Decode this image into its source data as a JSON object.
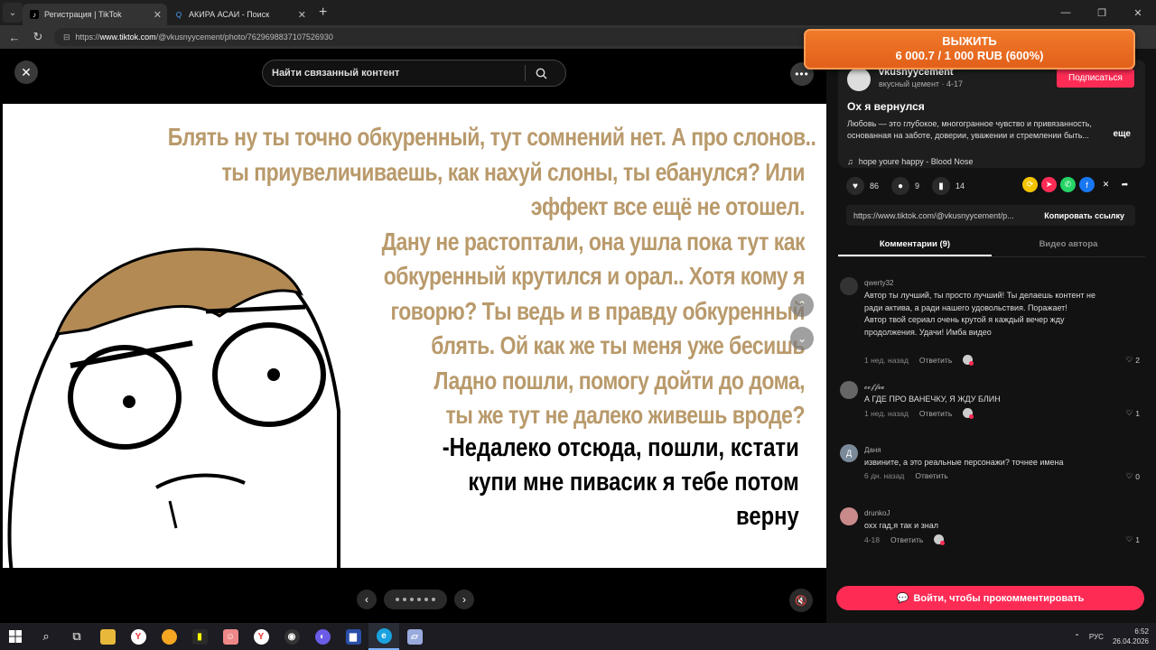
{
  "browser": {
    "tabs": [
      {
        "title": "Регистрация | TikTok",
        "active": true
      },
      {
        "title": "АКИРА АСАИ - Поиск",
        "active": false
      }
    ],
    "url_prefix": "https://",
    "url_domain": "www.tiktok.com",
    "url_path": "/@vkusnyycement/photo/7629698837107526930"
  },
  "viewer": {
    "search_placeholder": "Найти связанный контент",
    "meme_lines": [
      "Блять ну ты точно обкуренный, тут сомнений нет. А про слонов..",
      "ты приувеличиваешь, как нахуй слоны, ты ебанулся? Или",
      "эффект все ещё не отошел.",
      "Дану не растоптали, она ушла пока тут как",
      "обкуренный крутился и орал.. Хотя кому я",
      "говорю? Ты ведь и в правду обкуренный",
      "блять. Ой как же ты меня уже бесишь",
      "Ладно пошли, помогу дойти до дома,",
      "ты же тут не далеко живешь вроде?"
    ],
    "meme_reply": [
      "-Недалеко отсюда, пошли, кстати",
      "купи мне пивасик я тебе потом",
      "верну"
    ]
  },
  "promo": {
    "line1": "ВЫЖИТЬ",
    "line2": "6 000.7 / 1 000 RUB (600%)"
  },
  "author": {
    "name": "vkusnyycement",
    "meta": "вкусный цемент · 4-17",
    "follow_label": "Подписаться",
    "title": "Ох я вернулся",
    "description": "Любовь — это глубокое, многогранное чувство и привязанность, основанная на заботе, доверии, уважении и стремлении быть...",
    "more_label": "еще",
    "music": "hope youre happy - Blood Nose"
  },
  "stats": {
    "likes": "86",
    "comments": "9",
    "saves": "14"
  },
  "share": {
    "link": "https://www.tiktok.com/@vkusnyycement/p...",
    "copy_label": "Копировать ссылку"
  },
  "tabs": {
    "comments": "Комментарии (9)",
    "author_videos": "Видео автора"
  },
  "comments": [
    {
      "user": "qwerty32",
      "text": "Автор ты лучший, ты просто лучший! Ты делаешь контент не ради актива, а ради нашего удовольствия. Поражает!\nАвтор твой сериал очень крутой я каждый вечер жду продолжения. Удачи! Имба видео",
      "time": "1 нед. назад",
      "reply": "Ответить",
      "likes": "2"
    },
    {
      "user": "𝓬𝓸𝓯𝓯𝓮𝓮",
      "text": "А ГДЕ ПРО ВАНЕЧКУ, Я ЖДУ БЛИН",
      "time": "1 нед. назад",
      "reply": "Ответить",
      "likes": "1"
    },
    {
      "user": "Даня",
      "avatar_letter": "Д",
      "text": "извините, а это реальные персонажи? точнее имена",
      "time": "6 дн. назад",
      "reply": "Ответить",
      "likes": "0"
    },
    {
      "user": "drunkoJ",
      "text": "охх гад,я так и знал",
      "time": "4-18",
      "reply": "Ответить",
      "likes": "1"
    }
  ],
  "login_comment_label": "Войти, чтобы прокомментировать",
  "taskbar": {
    "lang": "РУС",
    "time": "6:52",
    "date": "26.04.2026"
  },
  "colors": {
    "accent": "#fe2c55",
    "meme_text": "#b99a6b",
    "promo": "#e2601a"
  }
}
